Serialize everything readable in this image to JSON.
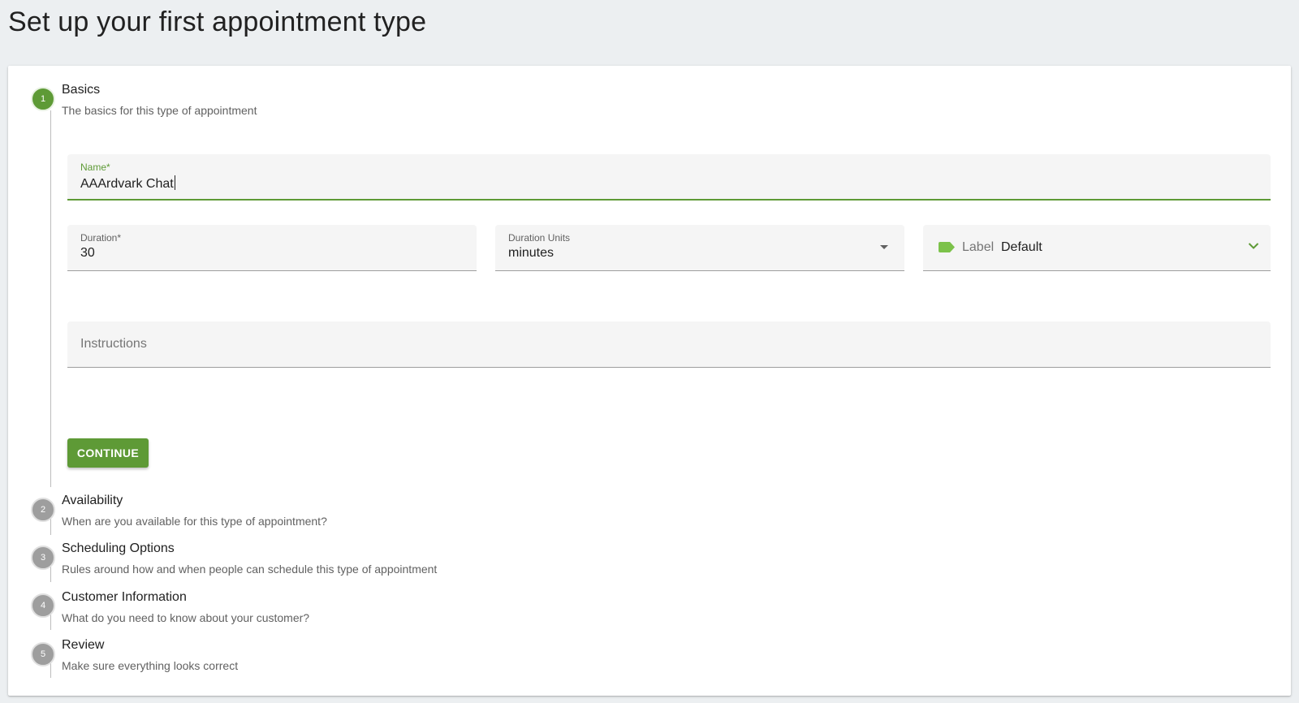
{
  "page": {
    "title": "Set up your first appointment type"
  },
  "steps": [
    {
      "number": "1",
      "title": "Basics",
      "description": "The basics for this type of appointment"
    },
    {
      "number": "2",
      "title": "Availability",
      "description": "When are you available for this type of appointment?"
    },
    {
      "number": "3",
      "title": "Scheduling Options",
      "description": "Rules around how and when people can schedule this type of appointment"
    },
    {
      "number": "4",
      "title": "Customer Information",
      "description": "What do you need to know about your customer?"
    },
    {
      "number": "5",
      "title": "Review",
      "description": "Make sure everything looks correct"
    }
  ],
  "form": {
    "name": {
      "label": "Name*",
      "value": "AAArdvark Chat"
    },
    "duration": {
      "label": "Duration*",
      "value": "30"
    },
    "duration_units": {
      "label": "Duration Units",
      "value": "minutes"
    },
    "label_select": {
      "label": "Label",
      "value": "Default"
    },
    "instructions": {
      "placeholder": "Instructions"
    },
    "continue_label": "CONTINUE"
  },
  "colors": {
    "accent": "#5e9a36",
    "label_tag": "#7cc24a",
    "inactive_step": "#9e9e9e"
  },
  "icons": {
    "label": "label-tag-icon",
    "units_dropdown": "arrow-drop-down-icon",
    "label_dropdown": "chevron-down-icon"
  }
}
